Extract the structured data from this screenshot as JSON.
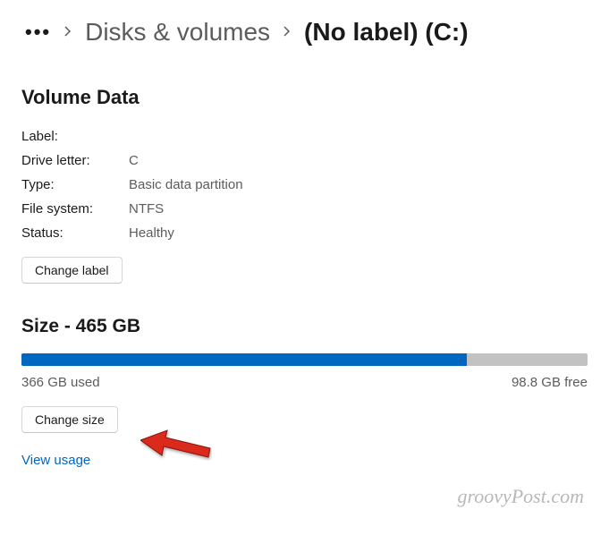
{
  "breadcrumb": {
    "parent": "Disks & volumes",
    "current": "(No label) (C:)"
  },
  "volumeData": {
    "title": "Volume Data",
    "labels": {
      "label": "Label:",
      "driveLetter": "Drive letter:",
      "type": "Type:",
      "fileSystem": "File system:",
      "status": "Status:"
    },
    "values": {
      "label": "",
      "driveLetter": "C",
      "type": "Basic data partition",
      "fileSystem": "NTFS",
      "status": "Healthy"
    },
    "changeLabelBtn": "Change label"
  },
  "size": {
    "title": "Size - 465 GB",
    "used": "366 GB used",
    "free": "98.8 GB free",
    "percent": 78.7,
    "changeSizeBtn": "Change size",
    "viewUsageLink": "View usage"
  },
  "watermark": "groovyPost.com"
}
